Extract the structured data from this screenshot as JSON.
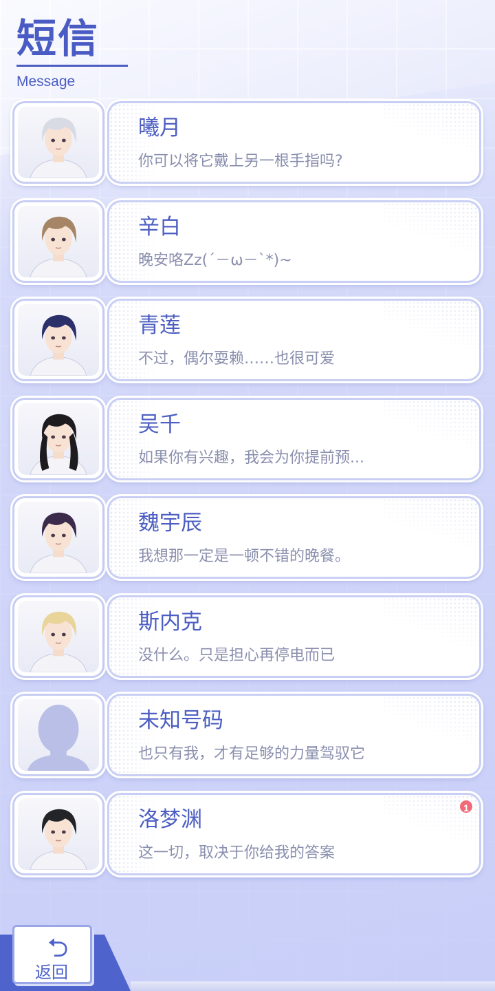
{
  "header": {
    "title": "短信",
    "subtitle": "Message"
  },
  "contacts": [
    {
      "name": "曦月",
      "preview": "你可以将它戴上另一根手指吗?",
      "avatar": "white-hair-man",
      "hair": "#d9dbe4",
      "unread": ""
    },
    {
      "name": "辛白",
      "preview": "晚安咯Zz(´－ω－`*)~",
      "avatar": "brown-hair-man",
      "hair": "#a58565",
      "unread": ""
    },
    {
      "name": "青莲",
      "preview": "不过，偶尔耍赖……也很可爱",
      "avatar": "navy-hair-man",
      "hair": "#2b2f6a",
      "unread": ""
    },
    {
      "name": "吴千",
      "preview": "如果你有兴趣，我会为你提前预...",
      "avatar": "long-black-hair-man",
      "hair": "#1e1b1f",
      "unread": ""
    },
    {
      "name": "魏宇辰",
      "preview": "我想那一定是一顿不错的晚餐。",
      "avatar": "purple-hair-man",
      "hair": "#3b2a4a",
      "unread": ""
    },
    {
      "name": "斯内克",
      "preview": "没什么。只是担心再停电而已",
      "avatar": "blonde-hair-man",
      "hair": "#e9d59a",
      "unread": ""
    },
    {
      "name": "未知号码",
      "preview": "也只有我，才有足够的力量驾驭它",
      "avatar": "unknown-silhouette",
      "hair": "#b9bfe6",
      "unread": ""
    },
    {
      "name": "洛梦渊",
      "preview": "这一切，取决于你给我的答案",
      "avatar": "dark-hair-man",
      "hair": "#232428",
      "unread": "1"
    }
  ],
  "footer": {
    "back_label": "返回",
    "back_icon": "return-arrow-icon"
  },
  "colors": {
    "accent": "#4a5cc4",
    "preview_text": "#8a8fae",
    "badge": "#f06a78"
  }
}
